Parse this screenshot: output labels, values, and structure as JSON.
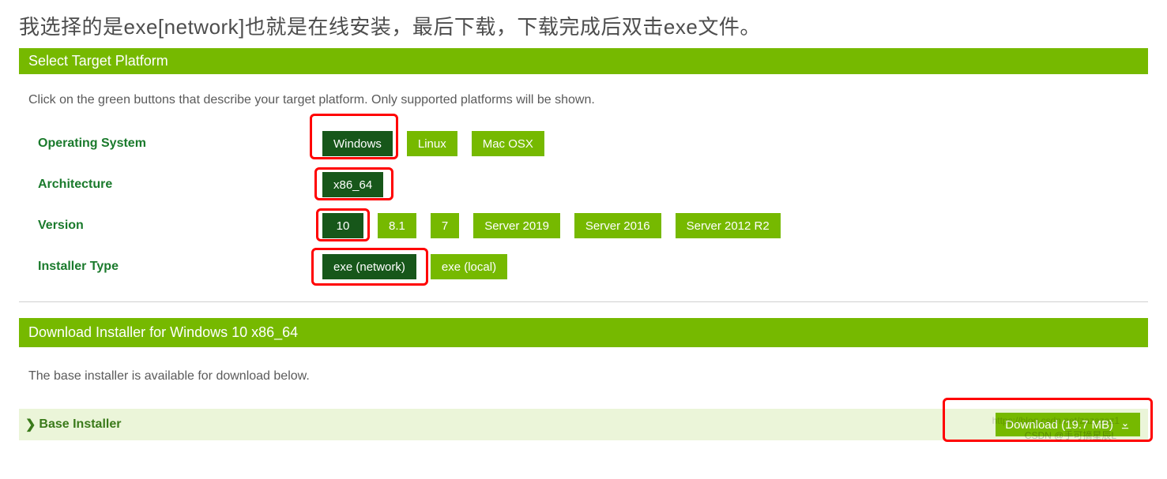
{
  "intro_text": "我选择的是exe[network]也就是在线安装，最后下载，下载完成后双击exe文件。",
  "section1_title": "Select Target Platform",
  "instruction": "Click on the green buttons that describe your target platform. Only supported platforms will be shown.",
  "rows": {
    "os": {
      "label": "Operating System",
      "options": [
        {
          "text": "Windows",
          "selected": true
        },
        {
          "text": "Linux",
          "selected": false
        },
        {
          "text": "Mac OSX",
          "selected": false
        }
      ]
    },
    "arch": {
      "label": "Architecture",
      "options": [
        {
          "text": "x86_64",
          "selected": true
        }
      ]
    },
    "version": {
      "label": "Version",
      "options": [
        {
          "text": "10",
          "selected": true
        },
        {
          "text": "8.1",
          "selected": false
        },
        {
          "text": "7",
          "selected": false
        },
        {
          "text": "Server 2019",
          "selected": false
        },
        {
          "text": "Server 2016",
          "selected": false
        },
        {
          "text": "Server 2012 R2",
          "selected": false
        }
      ]
    },
    "installer": {
      "label": "Installer Type",
      "options": [
        {
          "text": "exe (network)",
          "selected": true
        },
        {
          "text": "exe (local)",
          "selected": false
        }
      ]
    }
  },
  "section2_title": "Download Installer for Windows 10 x86_64",
  "base_text": "The base installer is available for download below.",
  "base_installer_label": "Base Installer",
  "download_label": "Download (19.7 MB)",
  "watermark_url": "https://blog.csdn.net/zazazaz1",
  "watermark_author": "CSDN @手可摘星辰L"
}
